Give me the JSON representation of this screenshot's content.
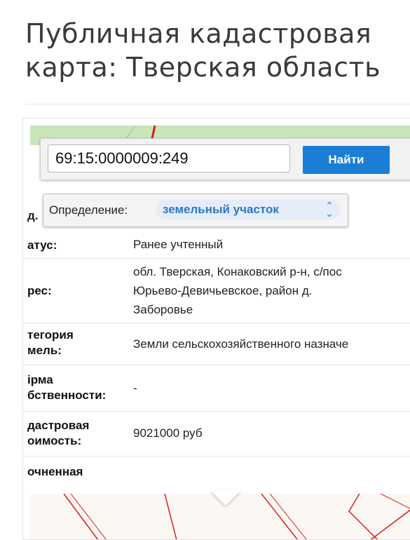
{
  "page": {
    "title": "Публичная кадастровая\nкарта: Тверская область"
  },
  "search": {
    "value": "69:15:0000009:249",
    "button_label": "Найти"
  },
  "definition": {
    "row_label": "д.",
    "label": "Определение:",
    "selected": "земельный участок"
  },
  "details": {
    "rows": [
      {
        "label": "атус:",
        "value": "Ранее учтенный"
      },
      {
        "label": "рес:",
        "value_lines": [
          "обл. Тверская, Конаковский р-н, с/пос",
          "Юрьево-Девичьевское, район д.",
          "Заборовье"
        ]
      },
      {
        "label": "тегория\nмель:",
        "value": "Земли сельскохозяйственного назначе"
      },
      {
        "label": "ірма\nбственности:",
        "value": "-"
      },
      {
        "label": "дастровая\nоимость:",
        "value": "9021000 руб"
      },
      {
        "label": "очненная",
        "value": ""
      }
    ]
  },
  "colors": {
    "accent": "#1a7fd4",
    "select_text": "#2c78c9",
    "map_green": "#c9e6b8",
    "parcel_red": "#d42020"
  },
  "icons": {
    "select": "chevron-up-down-icon"
  }
}
